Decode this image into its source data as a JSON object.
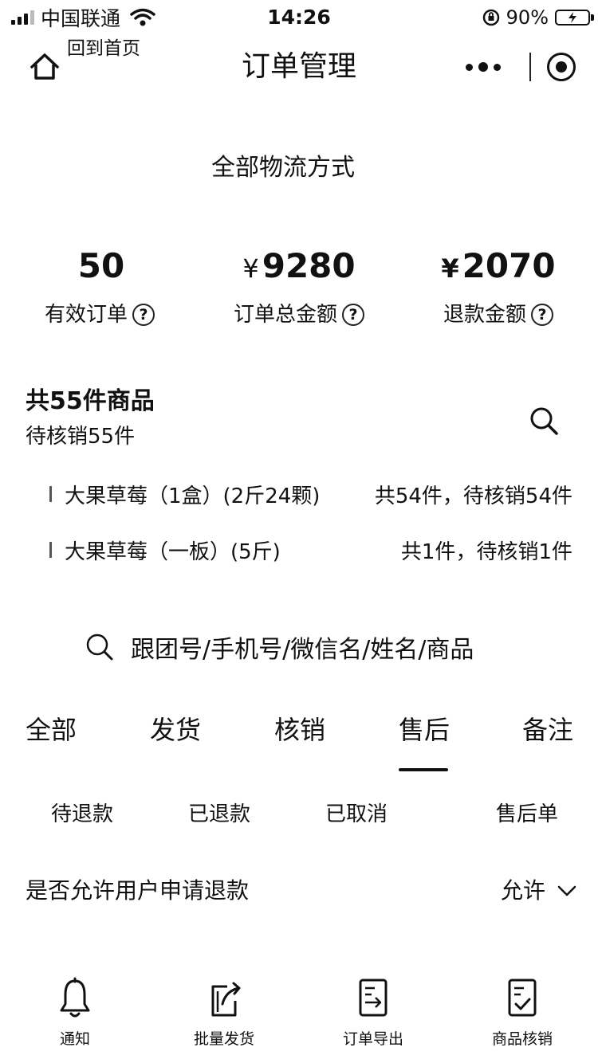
{
  "status_bar": {
    "carrier": "中国联通",
    "time": "14:26",
    "battery": "90%"
  },
  "nav": {
    "home_label": "回到首页",
    "title": "订单管理"
  },
  "logistics_filter": "全部物流方式",
  "stats": [
    {
      "value": "50",
      "currency": "",
      "label": "有效订单"
    },
    {
      "value": "9280",
      "currency": "¥",
      "label": "订单总金额"
    },
    {
      "value": "2070",
      "currency": "¥",
      "label": "退款金额"
    }
  ],
  "goods": {
    "total": "共55件商品",
    "pending": "待核销55件",
    "items": [
      {
        "name": "大果草莓（1盒）(2斤24颗)",
        "count": "共54件，待核销54件"
      },
      {
        "name": "大果草莓（一板）(5斤)",
        "count": "共1件，待核销1件"
      }
    ]
  },
  "search": {
    "placeholder": "跟团号/手机号/微信名/姓名/商品"
  },
  "tabs": [
    "全部",
    "发货",
    "核销",
    "售后",
    "备注"
  ],
  "active_tab": "售后",
  "sub_tabs": [
    "待退款",
    "已退款",
    "已取消",
    "售后单"
  ],
  "refund_setting": {
    "label": "是否允许用户申请退款",
    "value": "允许"
  },
  "bottom_nav": [
    {
      "label": "通知",
      "icon": "bell-icon"
    },
    {
      "label": "批量发货",
      "icon": "share-export-icon"
    },
    {
      "label": "订单导出",
      "icon": "document-export-icon"
    },
    {
      "label": "商品核销",
      "icon": "document-check-icon"
    }
  ]
}
